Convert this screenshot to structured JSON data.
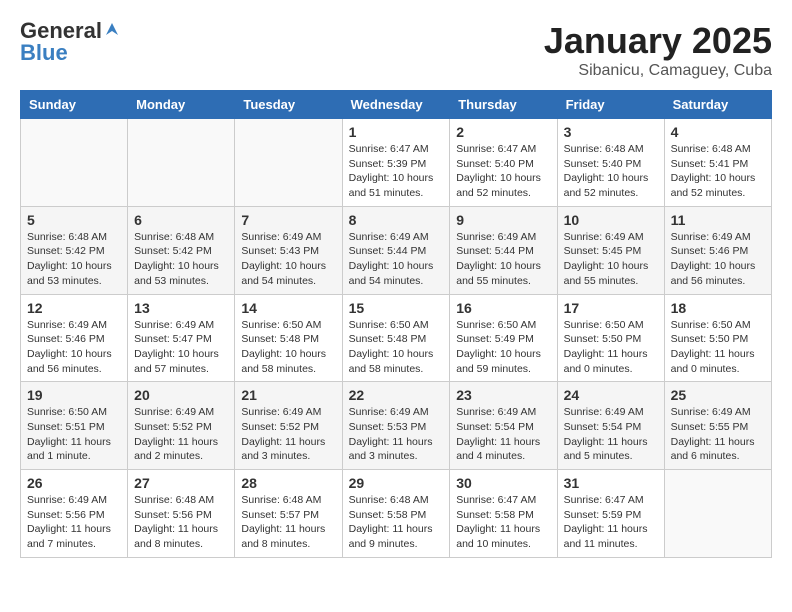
{
  "logo": {
    "general": "General",
    "blue": "Blue"
  },
  "title": {
    "month": "January 2025",
    "location": "Sibanicu, Camaguey, Cuba"
  },
  "weekdays": [
    "Sunday",
    "Monday",
    "Tuesday",
    "Wednesday",
    "Thursday",
    "Friday",
    "Saturday"
  ],
  "weeks": [
    [
      {
        "day": "",
        "info": ""
      },
      {
        "day": "",
        "info": ""
      },
      {
        "day": "",
        "info": ""
      },
      {
        "day": "1",
        "info": "Sunrise: 6:47 AM\nSunset: 5:39 PM\nDaylight: 10 hours\nand 51 minutes."
      },
      {
        "day": "2",
        "info": "Sunrise: 6:47 AM\nSunset: 5:40 PM\nDaylight: 10 hours\nand 52 minutes."
      },
      {
        "day": "3",
        "info": "Sunrise: 6:48 AM\nSunset: 5:40 PM\nDaylight: 10 hours\nand 52 minutes."
      },
      {
        "day": "4",
        "info": "Sunrise: 6:48 AM\nSunset: 5:41 PM\nDaylight: 10 hours\nand 52 minutes."
      }
    ],
    [
      {
        "day": "5",
        "info": "Sunrise: 6:48 AM\nSunset: 5:42 PM\nDaylight: 10 hours\nand 53 minutes."
      },
      {
        "day": "6",
        "info": "Sunrise: 6:48 AM\nSunset: 5:42 PM\nDaylight: 10 hours\nand 53 minutes."
      },
      {
        "day": "7",
        "info": "Sunrise: 6:49 AM\nSunset: 5:43 PM\nDaylight: 10 hours\nand 54 minutes."
      },
      {
        "day": "8",
        "info": "Sunrise: 6:49 AM\nSunset: 5:44 PM\nDaylight: 10 hours\nand 54 minutes."
      },
      {
        "day": "9",
        "info": "Sunrise: 6:49 AM\nSunset: 5:44 PM\nDaylight: 10 hours\nand 55 minutes."
      },
      {
        "day": "10",
        "info": "Sunrise: 6:49 AM\nSunset: 5:45 PM\nDaylight: 10 hours\nand 55 minutes."
      },
      {
        "day": "11",
        "info": "Sunrise: 6:49 AM\nSunset: 5:46 PM\nDaylight: 10 hours\nand 56 minutes."
      }
    ],
    [
      {
        "day": "12",
        "info": "Sunrise: 6:49 AM\nSunset: 5:46 PM\nDaylight: 10 hours\nand 56 minutes."
      },
      {
        "day": "13",
        "info": "Sunrise: 6:49 AM\nSunset: 5:47 PM\nDaylight: 10 hours\nand 57 minutes."
      },
      {
        "day": "14",
        "info": "Sunrise: 6:50 AM\nSunset: 5:48 PM\nDaylight: 10 hours\nand 58 minutes."
      },
      {
        "day": "15",
        "info": "Sunrise: 6:50 AM\nSunset: 5:48 PM\nDaylight: 10 hours\nand 58 minutes."
      },
      {
        "day": "16",
        "info": "Sunrise: 6:50 AM\nSunset: 5:49 PM\nDaylight: 10 hours\nand 59 minutes."
      },
      {
        "day": "17",
        "info": "Sunrise: 6:50 AM\nSunset: 5:50 PM\nDaylight: 11 hours\nand 0 minutes."
      },
      {
        "day": "18",
        "info": "Sunrise: 6:50 AM\nSunset: 5:50 PM\nDaylight: 11 hours\nand 0 minutes."
      }
    ],
    [
      {
        "day": "19",
        "info": "Sunrise: 6:50 AM\nSunset: 5:51 PM\nDaylight: 11 hours\nand 1 minute."
      },
      {
        "day": "20",
        "info": "Sunrise: 6:49 AM\nSunset: 5:52 PM\nDaylight: 11 hours\nand 2 minutes."
      },
      {
        "day": "21",
        "info": "Sunrise: 6:49 AM\nSunset: 5:52 PM\nDaylight: 11 hours\nand 3 minutes."
      },
      {
        "day": "22",
        "info": "Sunrise: 6:49 AM\nSunset: 5:53 PM\nDaylight: 11 hours\nand 3 minutes."
      },
      {
        "day": "23",
        "info": "Sunrise: 6:49 AM\nSunset: 5:54 PM\nDaylight: 11 hours\nand 4 minutes."
      },
      {
        "day": "24",
        "info": "Sunrise: 6:49 AM\nSunset: 5:54 PM\nDaylight: 11 hours\nand 5 minutes."
      },
      {
        "day": "25",
        "info": "Sunrise: 6:49 AM\nSunset: 5:55 PM\nDaylight: 11 hours\nand 6 minutes."
      }
    ],
    [
      {
        "day": "26",
        "info": "Sunrise: 6:49 AM\nSunset: 5:56 PM\nDaylight: 11 hours\nand 7 minutes."
      },
      {
        "day": "27",
        "info": "Sunrise: 6:48 AM\nSunset: 5:56 PM\nDaylight: 11 hours\nand 8 minutes."
      },
      {
        "day": "28",
        "info": "Sunrise: 6:48 AM\nSunset: 5:57 PM\nDaylight: 11 hours\nand 8 minutes."
      },
      {
        "day": "29",
        "info": "Sunrise: 6:48 AM\nSunset: 5:58 PM\nDaylight: 11 hours\nand 9 minutes."
      },
      {
        "day": "30",
        "info": "Sunrise: 6:47 AM\nSunset: 5:58 PM\nDaylight: 11 hours\nand 10 minutes."
      },
      {
        "day": "31",
        "info": "Sunrise: 6:47 AM\nSunset: 5:59 PM\nDaylight: 11 hours\nand 11 minutes."
      },
      {
        "day": "",
        "info": ""
      }
    ]
  ]
}
